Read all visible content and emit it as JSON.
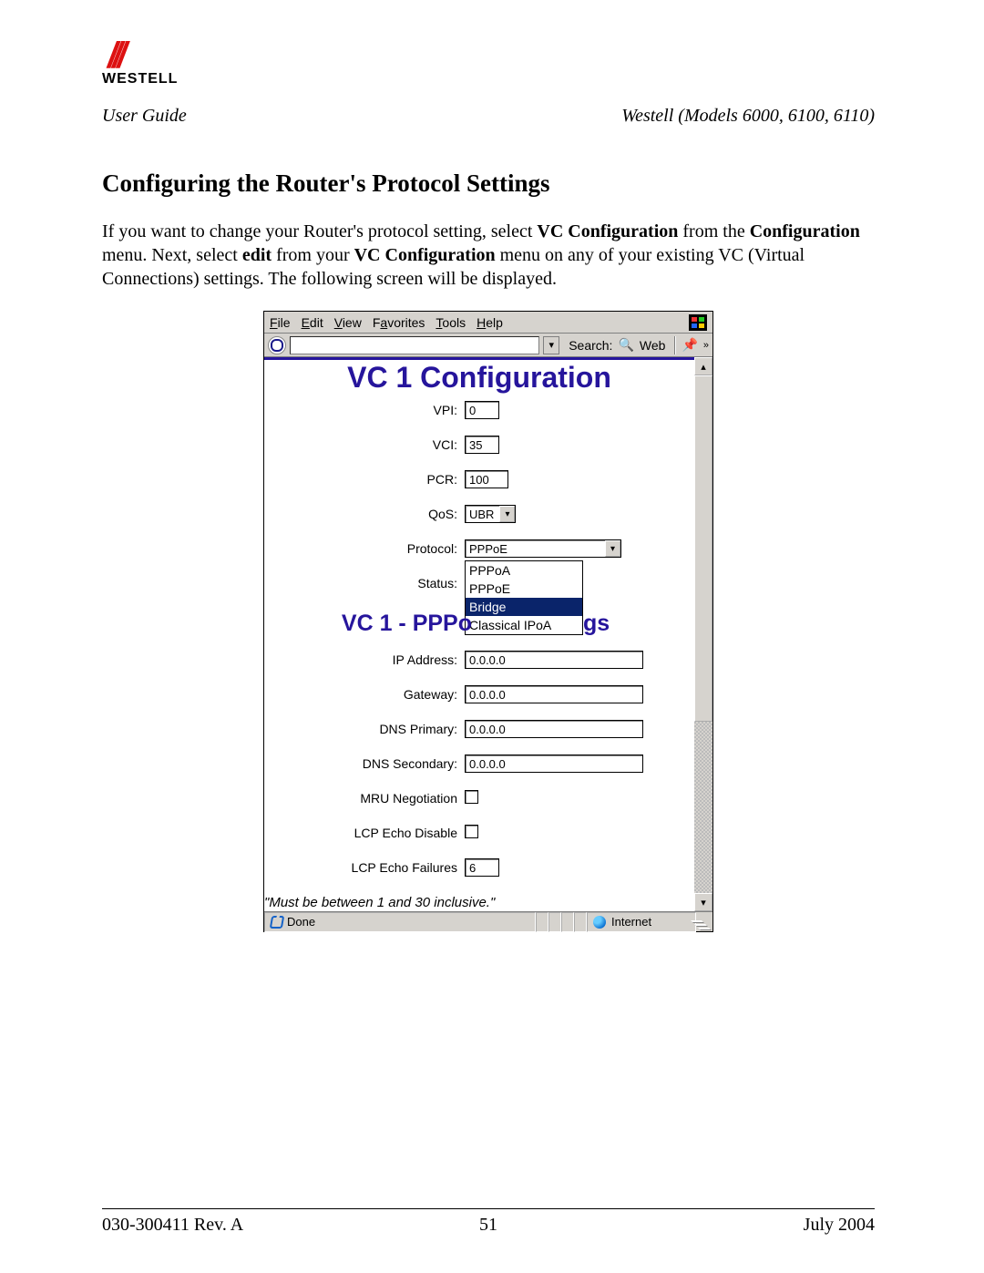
{
  "doc": {
    "guide_label": "User Guide",
    "model_label": "Westell (Models 6000, 6100, 6110)",
    "logo_text": "WESTELL",
    "section_title": "Configuring the Router's Protocol Settings",
    "para_html": "If you want to change your Router's protocol setting, select <b>VC Configuration</b> from the <b>Configuration</b> menu. Next, select <b>edit</b> from your <b>VC Configuration</b> menu on any of your existing VC (Virtual Connections) settings. The following screen will be displayed.",
    "footer_left": "030-300411 Rev. A",
    "footer_page": "51",
    "footer_right": "July 2004"
  },
  "menubar": [
    "File",
    "Edit",
    "View",
    "Favorites",
    "Tools",
    "Help"
  ],
  "toolbar": {
    "search_label": "Search:",
    "web_label": "Web",
    "more_glyph": "»"
  },
  "content": {
    "h1": "VC 1 Configuration",
    "sub_left": "VC 1 - PPPo",
    "sub_right": "gs",
    "hint": "\"Must be between 1 and 30 inclusive.\"",
    "fields": {
      "vpi": {
        "label": "VPI:",
        "value": "0"
      },
      "vci": {
        "label": "VCI:",
        "value": "35"
      },
      "pcr": {
        "label": "PCR:",
        "value": "100"
      },
      "qos": {
        "label": "QoS:",
        "value": "UBR"
      },
      "proto": {
        "label": "Protocol:",
        "value": "PPPoE"
      },
      "status": {
        "label": "Status:"
      },
      "ip": {
        "label": "IP Address:",
        "value": "0.0.0.0"
      },
      "gw": {
        "label": "Gateway:",
        "value": "0.0.0.0"
      },
      "dns1": {
        "label": "DNS Primary:",
        "value": "0.0.0.0"
      },
      "dns2": {
        "label": "DNS Secondary:",
        "value": "0.0.0.0"
      },
      "mru": {
        "label": "MRU Negotiation"
      },
      "lcpd": {
        "label": "LCP Echo Disable"
      },
      "lcpf": {
        "label": "LCP Echo Failures",
        "value": "6"
      }
    },
    "proto_options": [
      "PPPoA",
      "PPPoE",
      "Bridge",
      "Classical IPoA"
    ],
    "proto_selected_index": 2
  },
  "status": {
    "left": "Done",
    "right": "Internet"
  }
}
